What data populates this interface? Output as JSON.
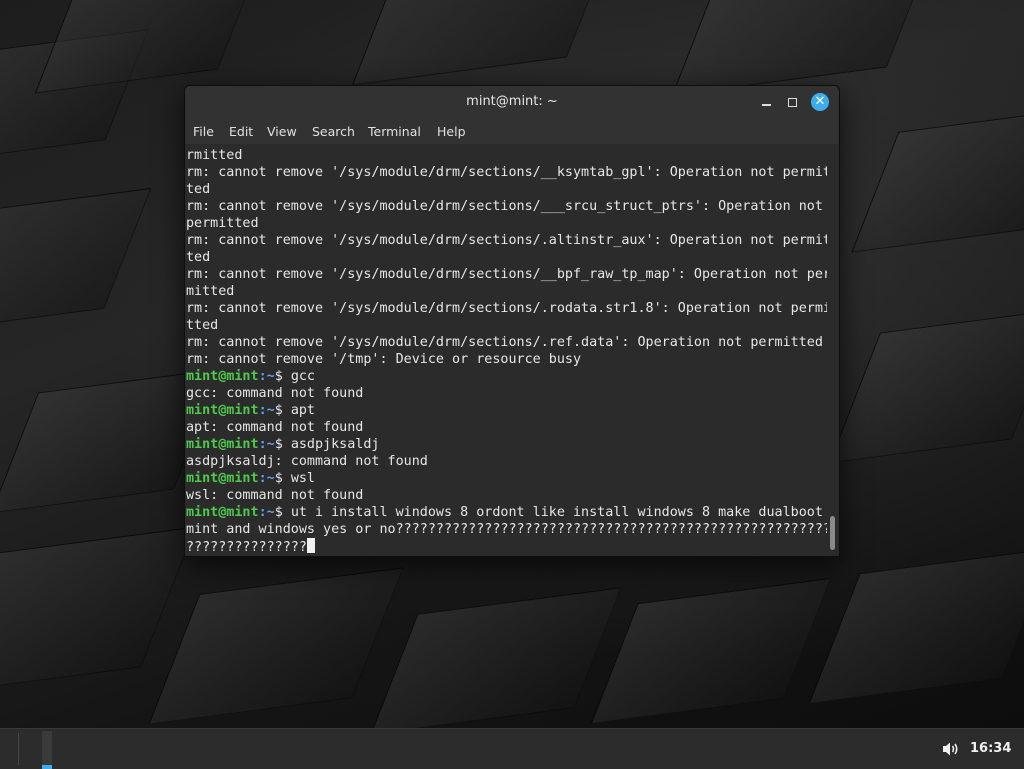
{
  "window": {
    "title": "mint@mint: ~",
    "controls": {
      "minimize_icon": "minimize-icon",
      "maximize_icon": "maximize-icon",
      "close_icon": "close-icon",
      "close_label": "✕"
    }
  },
  "menu": [
    "File",
    "Edit",
    "View",
    "Search",
    "Terminal",
    "Help"
  ],
  "terminal": {
    "lines": [
      {
        "text": "rmitted"
      },
      {
        "text": "rm: cannot remove '/sys/module/drm/sections/__ksymtab_gpl': Operation not permit"
      },
      {
        "text": "ted"
      },
      {
        "text": "rm: cannot remove '/sys/module/drm/sections/___srcu_struct_ptrs': Operation not"
      },
      {
        "text": "permitted"
      },
      {
        "text": "rm: cannot remove '/sys/module/drm/sections/.altinstr_aux': Operation not permit"
      },
      {
        "text": "ted"
      },
      {
        "text": "rm: cannot remove '/sys/module/drm/sections/__bpf_raw_tp_map': Operation not per"
      },
      {
        "text": "mitted"
      },
      {
        "text": "rm: cannot remove '/sys/module/drm/sections/.rodata.str1.8': Operation not permi"
      },
      {
        "text": "tted"
      },
      {
        "text": "rm: cannot remove '/sys/module/drm/sections/.ref.data': Operation not permitted"
      },
      {
        "text": "rm: cannot remove '/tmp': Device or resource busy"
      },
      {
        "prompt": true,
        "text": "gcc"
      },
      {
        "text": "gcc: command not found"
      },
      {
        "prompt": true,
        "text": "apt"
      },
      {
        "text": "apt: command not found"
      },
      {
        "prompt": true,
        "text": "asdpjksaldj"
      },
      {
        "text": "asdpjksaldj: command not found"
      },
      {
        "prompt": true,
        "text": "wsl"
      },
      {
        "text": "wsl: command not found"
      },
      {
        "prompt": true,
        "text": "ut i install windows 8 ordont like install windows 8 make dualboot"
      },
      {
        "text": "mint and windows yes or no????????????????????????????????????????????????????????"
      },
      {
        "text": "???????????????",
        "cursor": true
      }
    ],
    "prompt_user": "mint@mint",
    "prompt_path": ":~",
    "prompt_symbol": "$ "
  },
  "taskbar": {
    "clock": "16:34",
    "volume_icon": "volume-icon"
  },
  "colors": {
    "accent": "#3daee9",
    "prompt_user": "#4ec94e",
    "prompt_path": "#5fa2e8",
    "terminal_bg": "#2b2b2b"
  }
}
